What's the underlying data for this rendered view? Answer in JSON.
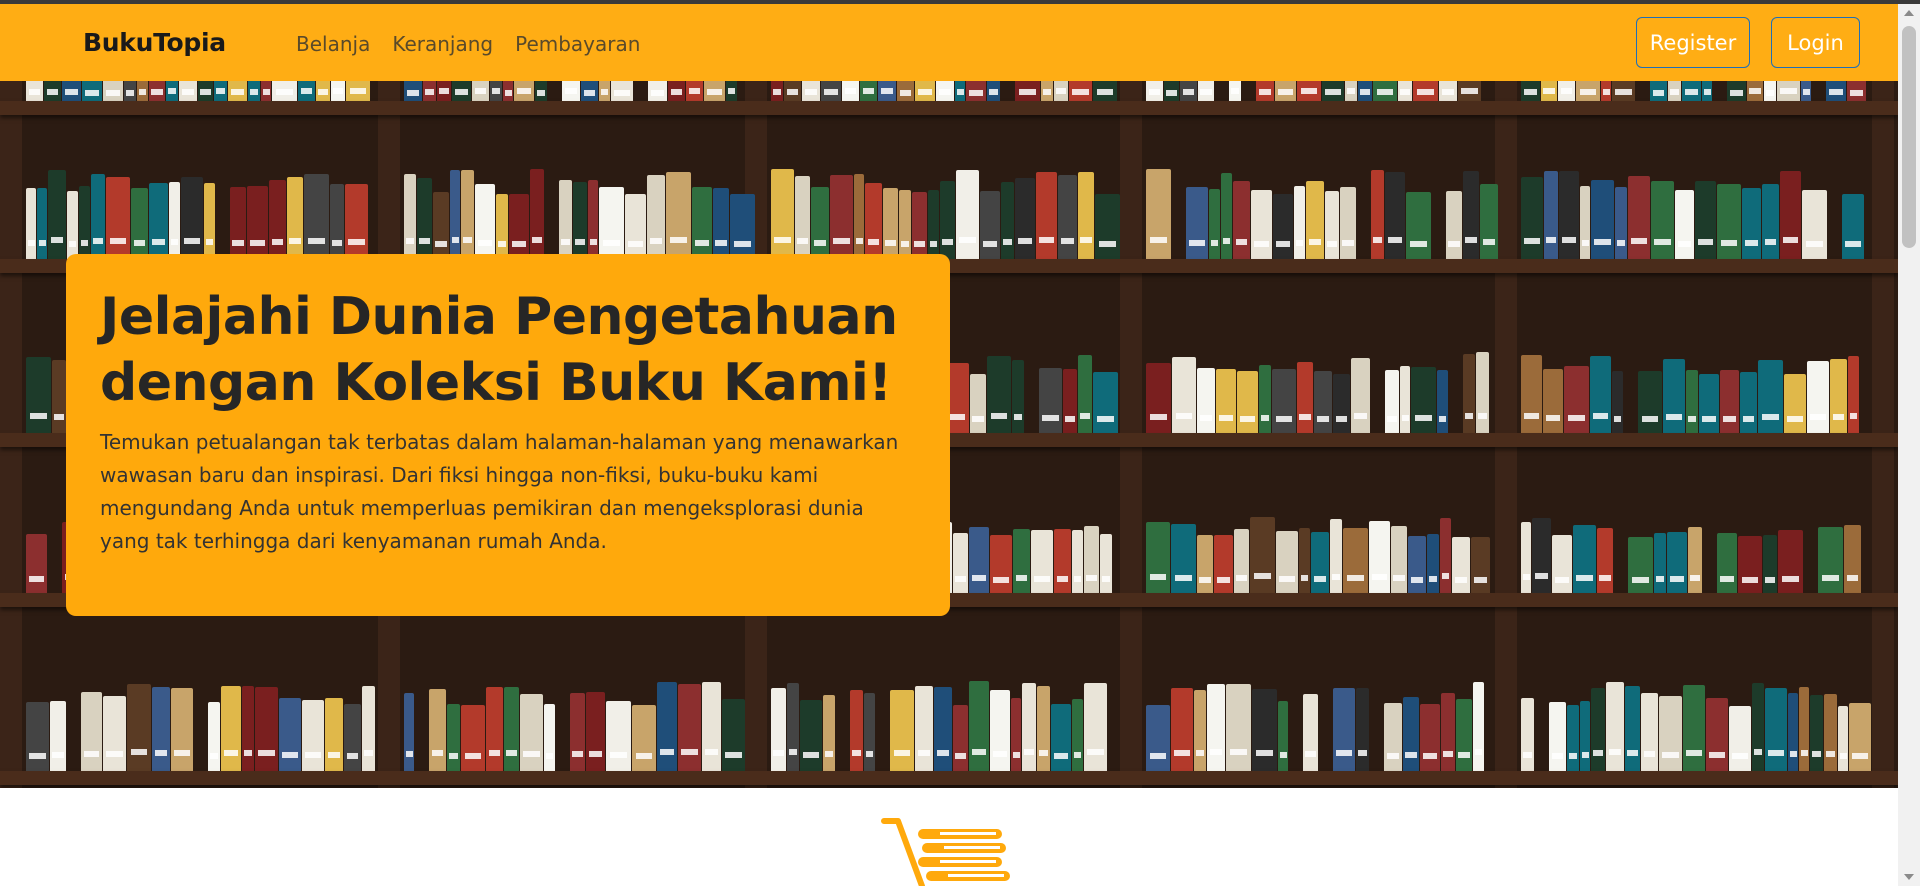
{
  "navbar": {
    "brand": "BukuTopia",
    "links": [
      "Belanja",
      "Keranjang",
      "Pembayaran"
    ],
    "register_label": "Register",
    "login_label": "Login",
    "background": "#ffad14"
  },
  "hero": {
    "title": "Jelajahi Dunia Pengetahuan dengan Koleksi Buku Kami!",
    "description": "Temukan petualangan tak terbatas dalam halaman-halaman yang menawarkan wawasan baru dan inspirasi. Dari fiksi hingga non-fiksi, buku-buku kami mengundang Anda untuk memperluas pemikiran dan mengeksplorasi dunia yang tak terhingga dari kenyamanan rumah Anda.",
    "background_image": "bookshelf-photo",
    "card_color": "#ffa90c"
  },
  "section": {
    "logo_icon": "book-cart-icon",
    "accent": "#ffa90c"
  }
}
